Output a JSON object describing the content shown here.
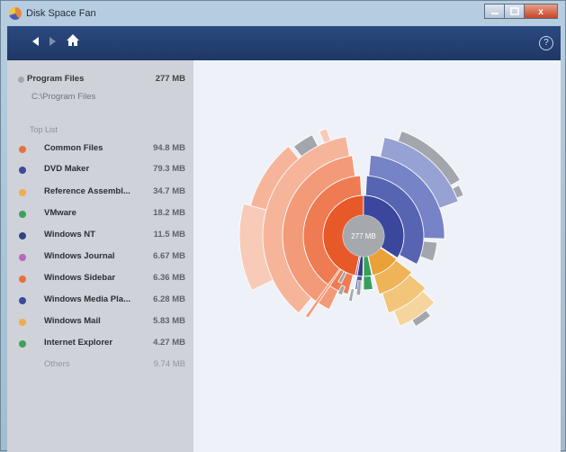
{
  "window": {
    "title": "Disk Space Fan",
    "close_glyph": "x"
  },
  "nav": {
    "back_icon": "back-arrow-icon",
    "forward_icon": "forward-arrow-icon",
    "home_icon": "home-icon",
    "help_label": "?"
  },
  "root": {
    "name": "Program Files",
    "size": "277 MB",
    "path": "C:\\Program Files"
  },
  "toplist": {
    "heading": "Top List",
    "items": [
      {
        "name": "Common Files",
        "size": "94.8 MB",
        "color": "#e8703e"
      },
      {
        "name": "DVD Maker",
        "size": "79.3 MB",
        "color": "#3d4a9c"
      },
      {
        "name": "Reference Assembl...",
        "size": "34.7 MB",
        "color": "#efad4a"
      },
      {
        "name": "VMware",
        "size": "18.2 MB",
        "color": "#3da15a"
      },
      {
        "name": "Windows NT",
        "size": "11.5 MB",
        "color": "#34437f"
      },
      {
        "name": "Windows Journal",
        "size": "6.67 MB",
        "color": "#b46abf"
      },
      {
        "name": "Windows Sidebar",
        "size": "6.36 MB",
        "color": "#e8703e"
      },
      {
        "name": "Windows Media Pla...",
        "size": "6.28 MB",
        "color": "#3d4a9c"
      },
      {
        "name": "Windows Mail",
        "size": "5.83 MB",
        "color": "#efad4a"
      },
      {
        "name": "Internet Explorer",
        "size": "4.27 MB",
        "color": "#3da15a"
      }
    ],
    "others": {
      "name": "Others",
      "size": "9.74 MB"
    }
  },
  "center": {
    "label": "277 MB"
  }
}
